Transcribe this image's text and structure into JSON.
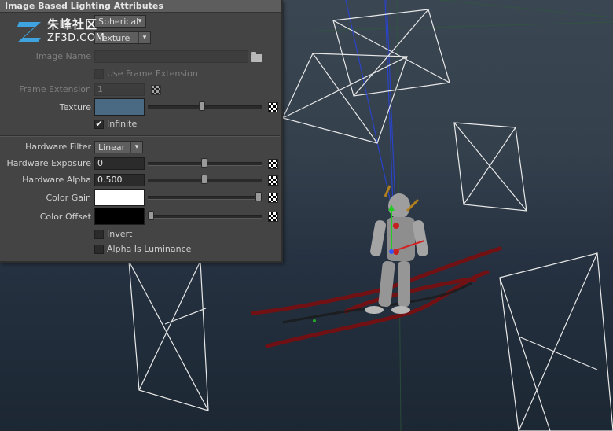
{
  "panel": {
    "title": "Image Based Lighting Attributes",
    "mapping_value": "Spherical",
    "type_value": "Texture",
    "image_name_label": "Image Name",
    "image_name_value": "",
    "use_frame_extension_label": "Use Frame Extension",
    "frame_extension_label": "Frame Extension",
    "frame_extension_value": "1",
    "texture_label": "Texture",
    "texture_color": "#4a6a84",
    "infinite_label": "Infinite",
    "infinite_checked": "✔",
    "hardware_filter_label": "Hardware Filter",
    "hardware_filter_value": "Linear",
    "hardware_exposure_label": "Hardware Exposure",
    "hardware_exposure_value": "0",
    "hardware_alpha_label": "Hardware Alpha",
    "hardware_alpha_value": "0.500",
    "color_gain_label": "Color Gain",
    "color_gain_color": "#ffffff",
    "color_offset_label": "Color Offset",
    "color_offset_color": "#000000",
    "invert_label": "Invert",
    "alpha_is_luminance_label": "Alpha Is Luminance"
  },
  "icons": {
    "dropdown": "▾",
    "checkmark": "✔"
  },
  "watermark": {
    "chinese": "朱峰社区",
    "english": "ZF3D.COM"
  }
}
